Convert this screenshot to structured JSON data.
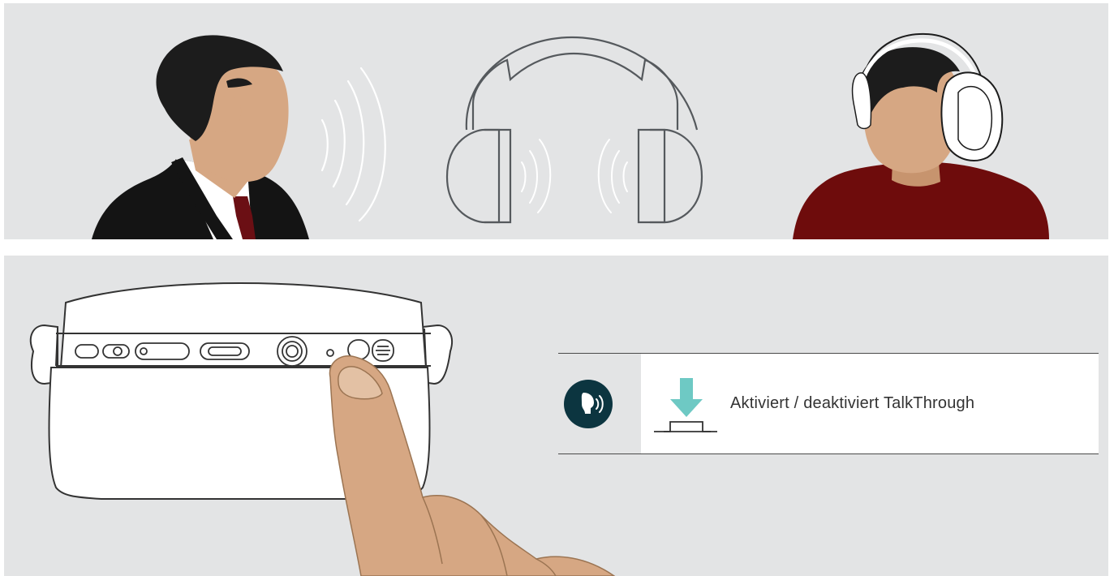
{
  "scene": {
    "top_illustration": {
      "figures": [
        "person-speaking",
        "headphones-with-sound-waves",
        "person-wearing-headphones"
      ]
    },
    "bottom_illustration": {
      "figures": [
        "headset-underside-controls",
        "finger-pressing-button"
      ]
    }
  },
  "legend": {
    "talkthrough_icon": "talkthrough-icon",
    "press_icon": "press-button-icon",
    "description": "Aktiviert / deaktiviert TalkThrough"
  },
  "colors": {
    "panel_background": "#e3e4e5",
    "skin": "#d6a783",
    "hair": "#1c1c1c",
    "suit": "#141414",
    "tie": "#6b0f14",
    "shirt_red": "#6e0c0c",
    "line": "#55595d",
    "talkthrough_icon_bg": "#0c3540",
    "press_arrow": "#6ec9c4"
  }
}
